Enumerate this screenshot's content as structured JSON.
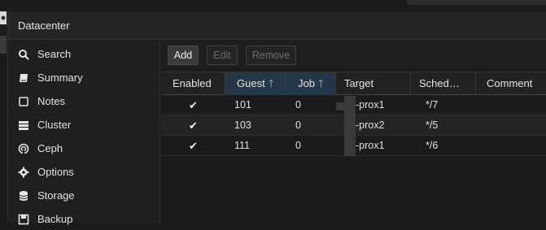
{
  "panel": {
    "title": "Datacenter"
  },
  "nav": {
    "items": [
      {
        "label": "Search",
        "icon": "search-icon"
      },
      {
        "label": "Summary",
        "icon": "book-icon"
      },
      {
        "label": "Notes",
        "icon": "note-icon"
      },
      {
        "label": "Cluster",
        "icon": "server-icon"
      },
      {
        "label": "Ceph",
        "icon": "ceph-icon"
      },
      {
        "label": "Options",
        "icon": "gear-icon"
      },
      {
        "label": "Storage",
        "icon": "database-icon"
      },
      {
        "label": "Backup",
        "icon": "floppy-icon"
      }
    ]
  },
  "toolbar": {
    "add_label": "Add",
    "edit_label": "Edit",
    "remove_label": "Remove"
  },
  "grid": {
    "columns": [
      {
        "label": "Enabled"
      },
      {
        "label": "Guest",
        "sort": "asc"
      },
      {
        "label": "Job",
        "sort": "asc"
      },
      {
        "label": "Target"
      },
      {
        "label": "Sched…"
      },
      {
        "label": "Comment"
      }
    ],
    "rows": [
      {
        "enabled": "✔",
        "guest": "101",
        "job": "0",
        "target": "-prox1",
        "schedule": "*/7",
        "comment": ""
      },
      {
        "enabled": "✔",
        "guest": "103",
        "job": "0",
        "target": "-prox2",
        "schedule": "*/5",
        "comment": ""
      },
      {
        "enabled": "✔",
        "guest": "111",
        "job": "0",
        "target": "-prox1",
        "schedule": "*/6",
        "comment": ""
      }
    ]
  },
  "colors": {
    "sorted_header": "#27374a",
    "background": "#1b1b1b"
  }
}
